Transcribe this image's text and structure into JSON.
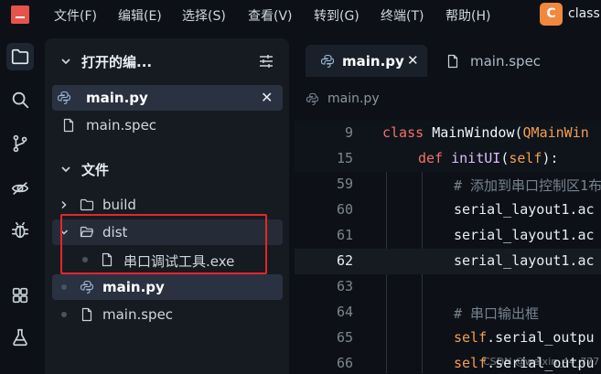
{
  "menu": {
    "items": [
      "文件(F)",
      "编辑(E)",
      "选择(S)",
      "查看(V)",
      "转到(G)",
      "终端(T)",
      "帮助(H)"
    ],
    "workspace_initial": "C",
    "workspace_name": "class"
  },
  "activity_bar": {
    "icons": [
      "files-icon",
      "search-icon",
      "source-control-icon",
      "remote-explorer-icon",
      "debug-icon",
      "extensions-icon",
      "testing-icon"
    ]
  },
  "sidebar": {
    "open_editors": {
      "title": "打开的编...",
      "files": [
        {
          "name": "main.py",
          "active": true
        },
        {
          "name": "main.spec",
          "active": false
        }
      ]
    },
    "folder": {
      "title": "文件",
      "items": [
        {
          "name": "build",
          "type": "folder",
          "expanded": false
        },
        {
          "name": "dist",
          "type": "folder",
          "expanded": true
        },
        {
          "name": "串口调试工具.exe",
          "type": "file"
        },
        {
          "name": "main.py",
          "type": "python"
        },
        {
          "name": "main.spec",
          "type": "file"
        }
      ]
    }
  },
  "editor": {
    "tabs": [
      {
        "name": "main.py",
        "active": true
      },
      {
        "name": "main.spec",
        "active": false
      }
    ],
    "breadcrumb": "main.py",
    "lines": [
      {
        "num": "9",
        "text": "class MainWindow(QMainWin"
      },
      {
        "num": "15",
        "text": "def initUI(self):"
      },
      {
        "num": "59",
        "text": "# 添加到串口控制区1布"
      },
      {
        "num": "60",
        "text": "serial_layout1.ac"
      },
      {
        "num": "61",
        "text": "serial_layout1.ac"
      },
      {
        "num": "62",
        "text": "serial_layout1.ac"
      },
      {
        "num": "63",
        "text": ""
      },
      {
        "num": "64",
        "text": "# 串口输出框"
      },
      {
        "num": "65",
        "text": "self.serial_outpu"
      },
      {
        "num": "66",
        "text": "self.serial_outpu"
      }
    ]
  },
  "watermark": "CSDN @weixin_44_777"
}
